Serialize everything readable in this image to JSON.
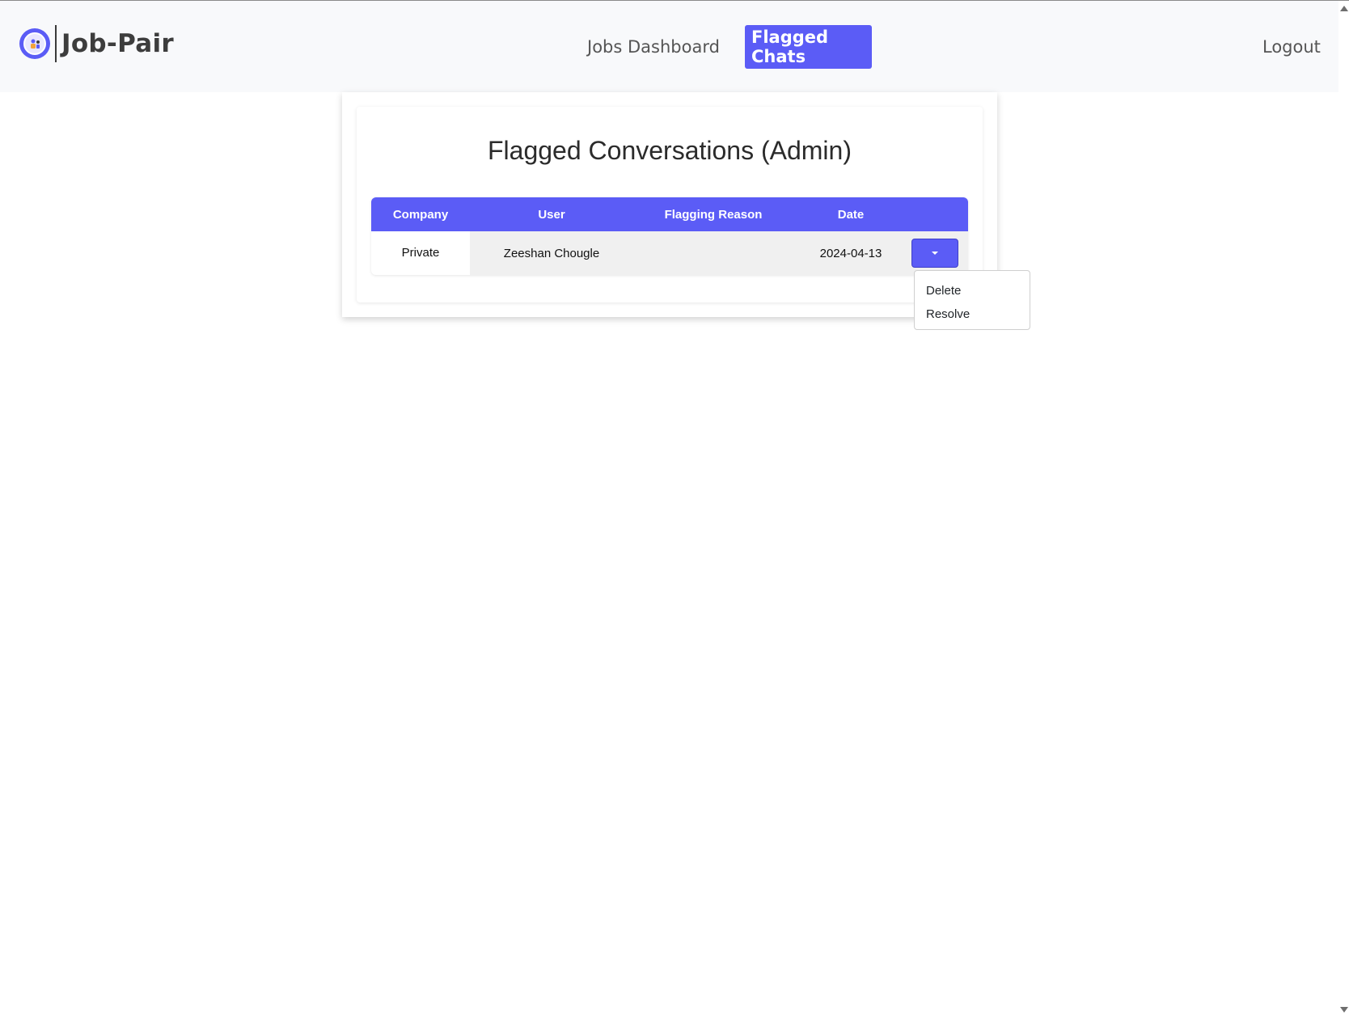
{
  "navbar": {
    "brand": "Job-Pair",
    "links": {
      "jobs_dashboard": "Jobs Dashboard",
      "flagged_chats": "Flagged Chats",
      "logout": "Logout"
    },
    "active_link": "Flagged Chats"
  },
  "page": {
    "title": "Flagged Conversations (Admin)"
  },
  "table": {
    "headers": [
      "Company",
      "User",
      "Flagging Reason",
      "Date",
      ""
    ],
    "rows": [
      {
        "company": "Private",
        "user": "Zeeshan Chougle",
        "reason": "",
        "date": "2024-04-13"
      }
    ]
  },
  "dropdown": {
    "items": [
      "Delete",
      "Resolve"
    ]
  },
  "colors": {
    "accent": "#5b5cf6",
    "navbar_bg": "#f8f9fb",
    "row_bg": "#f0f0f0"
  }
}
